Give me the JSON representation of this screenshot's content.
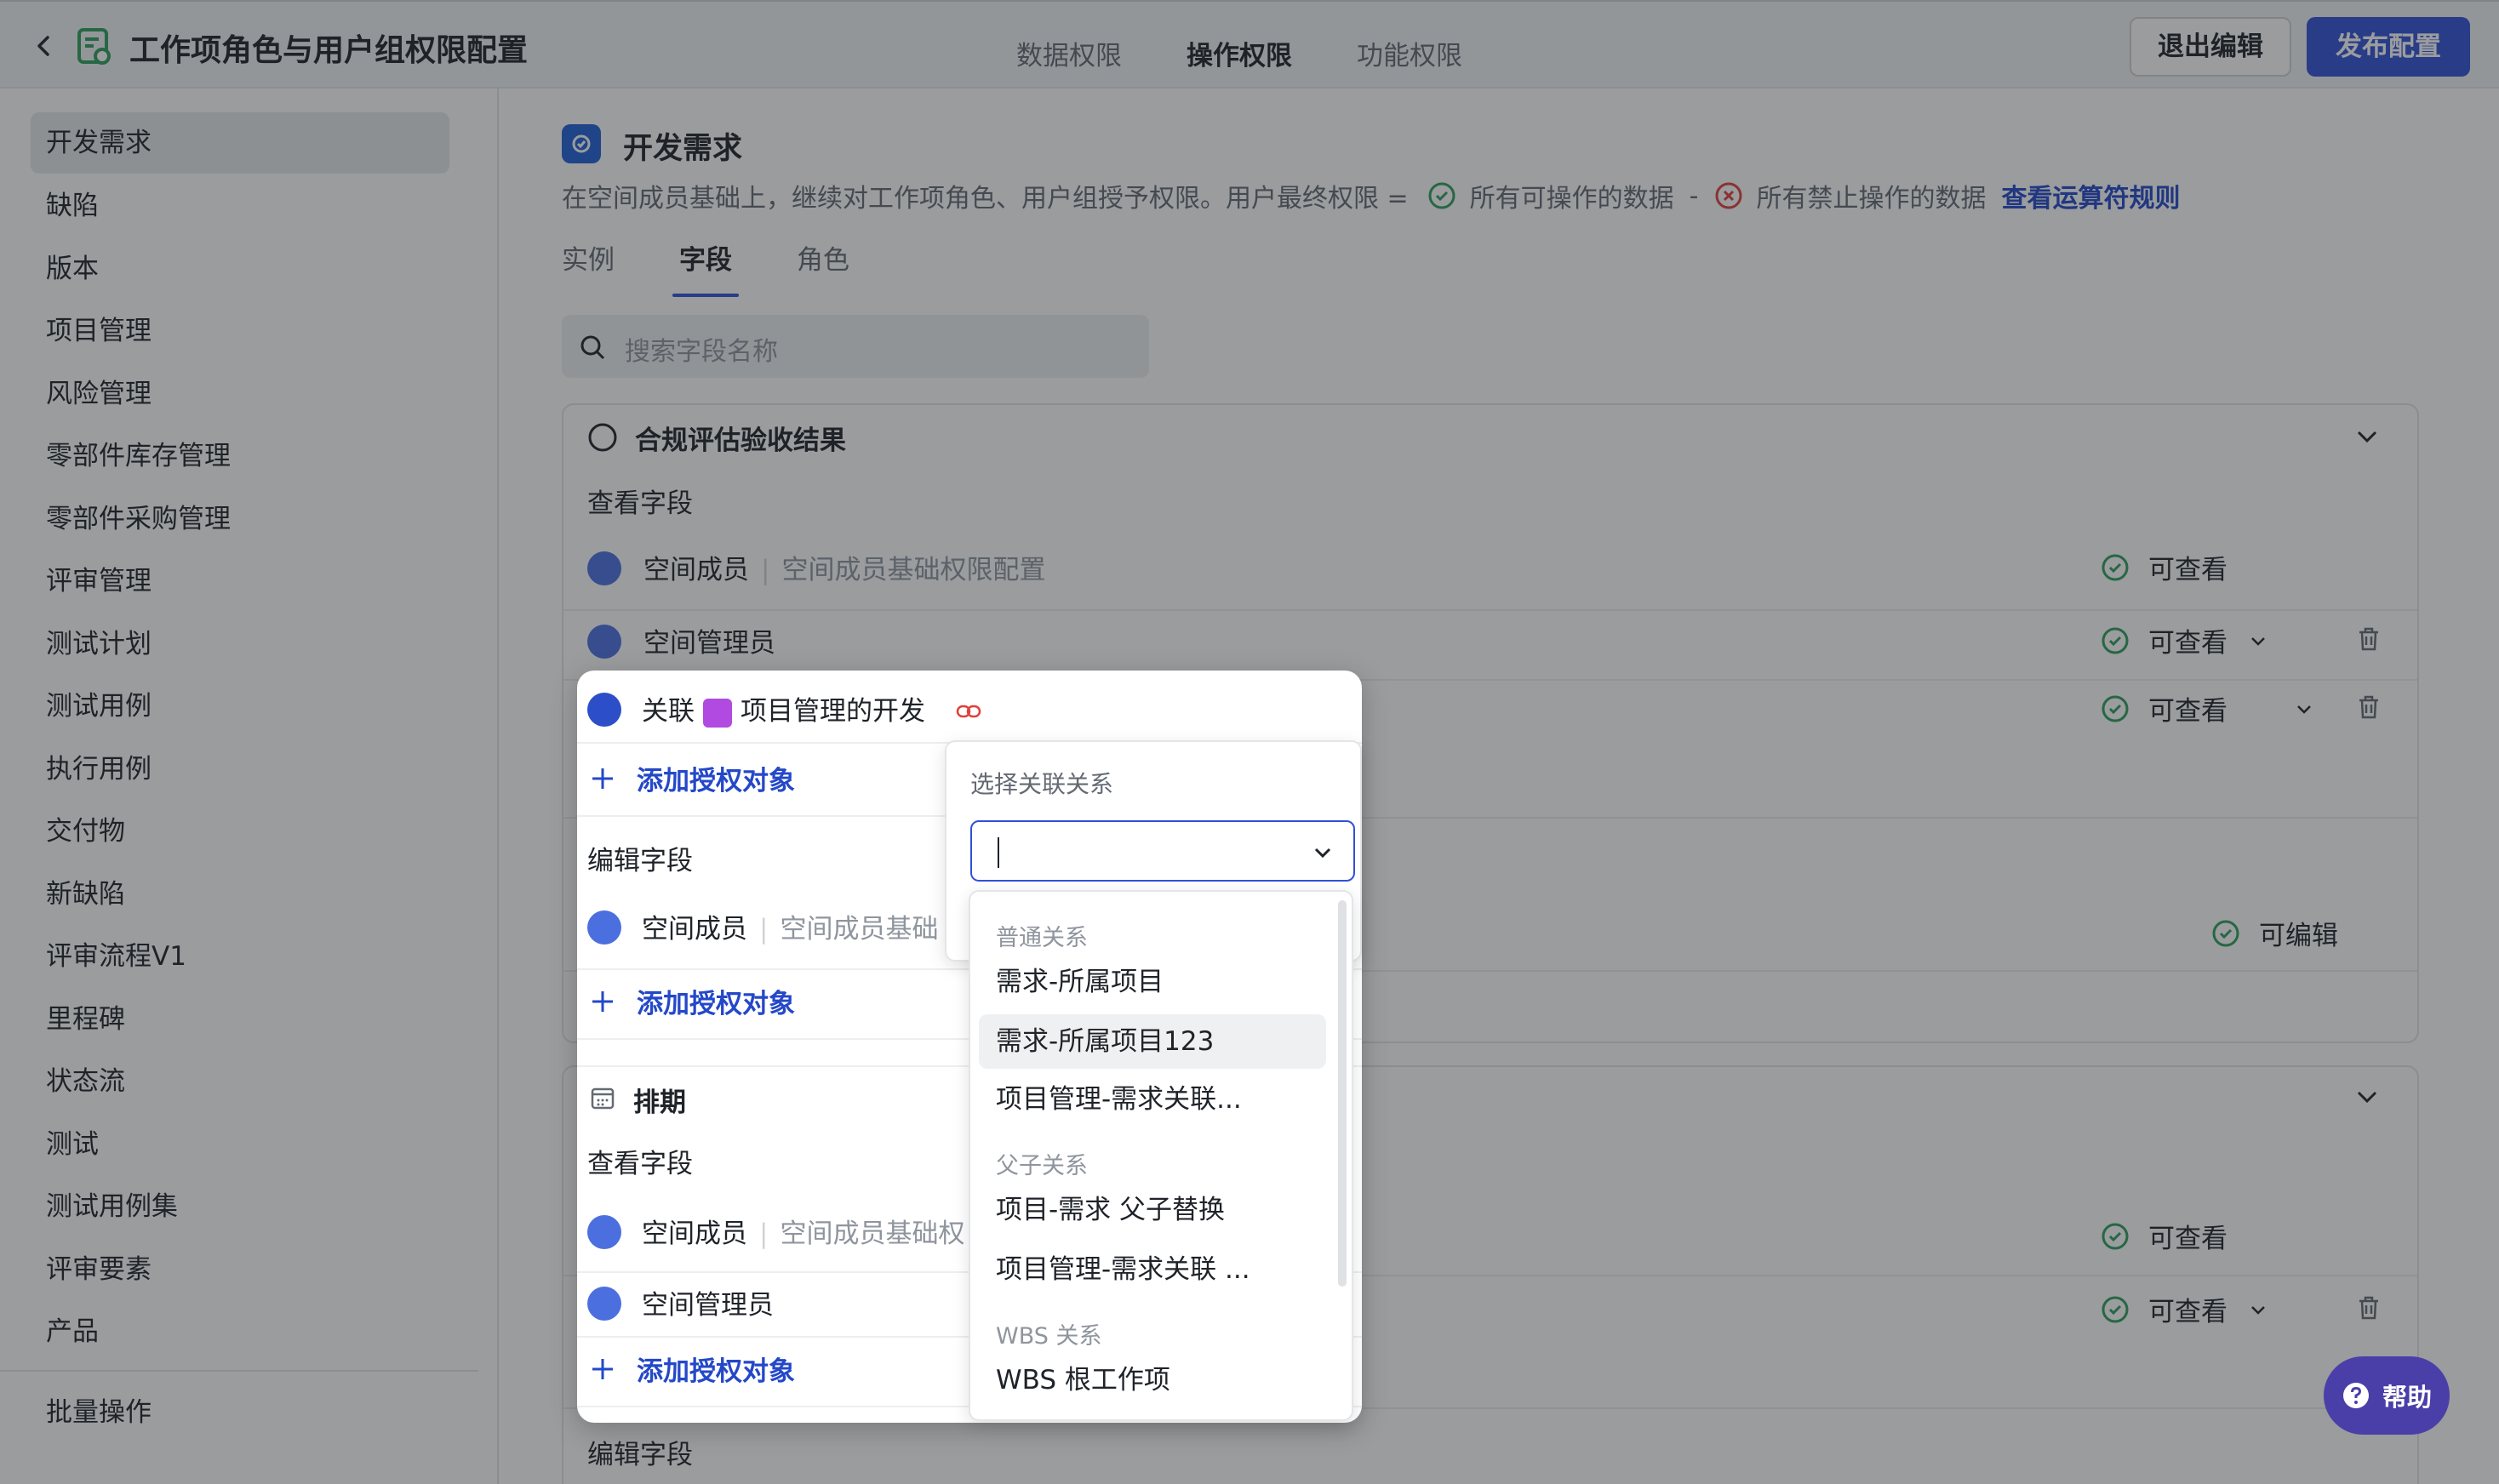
{
  "header": {
    "title": "工作项角色与用户组权限配置",
    "tabs": [
      "数据权限",
      "操作权限",
      "功能权限"
    ],
    "exit_label": "退出编辑",
    "publish_label": "发布配置"
  },
  "sidebar": {
    "items": [
      "开发需求",
      "缺陷",
      "版本",
      "项目管理",
      "风险管理",
      "零部件库存管理",
      "零部件采购管理",
      "评审管理",
      "测试计划",
      "测试用例",
      "执行用例",
      "交付物",
      "新缺陷",
      "评审流程V1",
      "里程碑",
      "状态流",
      "测试",
      "测试用例集",
      "评审要素",
      "产品"
    ],
    "bulk": "批量操作"
  },
  "main": {
    "title": "开发需求",
    "desc_prefix": "在空间成员基础上，继续对工作项角色、用户组授予权限。用户最终权限 =",
    "desc_allowed": "所有可操作的数据",
    "desc_minus": "-",
    "desc_denied": "所有禁止操作的数据",
    "desc_link": "查看运算符规则",
    "tabs": [
      "实例",
      "字段",
      "角色"
    ],
    "search_placeholder": "搜索字段名称"
  },
  "card1": {
    "title": "合规评估验收结果",
    "view_label": "查看字段",
    "member": "空间成员",
    "member_desc": "空间成员基础权限配置",
    "admin": "空间管理员",
    "perm_view": "可查看",
    "perm_edit": "可编辑"
  },
  "card2": {
    "edit_label": "编辑字段"
  },
  "popup": {
    "rel_prefix": "关联",
    "rel_name": "项目管理的开发",
    "add_label": "添加授权对象",
    "edit_label": "编辑字段",
    "member": "空间成员",
    "member_desc_short": "空间成员基础",
    "schedule_title": "排期",
    "view_label": "查看字段",
    "member_desc_mid": "空间成员基础权",
    "admin": "空间管理员"
  },
  "relation": {
    "title": "选择关联关系",
    "value": "",
    "groups": [
      {
        "label": "普通关系",
        "options": [
          "需求-所属项目",
          "需求-所属项目123",
          "项目管理-需求关联..."
        ]
      },
      {
        "label": "父子关系",
        "options": [
          "项目-需求 父子替换",
          "项目管理-需求关联 ..."
        ]
      },
      {
        "label": "WBS 关系",
        "options": [
          "WBS 根工作项"
        ]
      }
    ]
  },
  "help_label": "帮助",
  "colors": {
    "accent": "#3250d8",
    "ok": "#2e9e5b",
    "danger": "#e0403a",
    "link": "#2448c8"
  }
}
